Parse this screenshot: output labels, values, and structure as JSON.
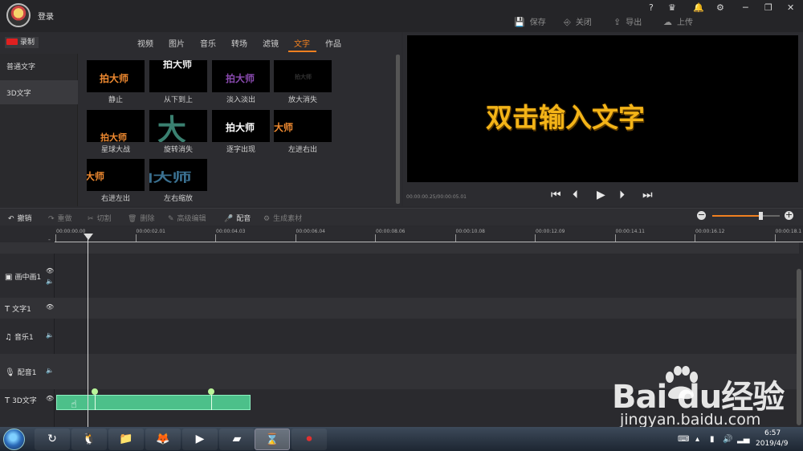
{
  "header": {
    "login": "登录",
    "icons": [
      "help-icon",
      "vip-icon",
      "notification-icon",
      "settings-icon",
      "minimize-icon",
      "restore-icon",
      "close-icon"
    ],
    "help": "?",
    "actions": [
      {
        "label": "保存",
        "icon": "💾"
      },
      {
        "label": "关闭",
        "icon": "⎆"
      },
      {
        "label": "导出",
        "icon": "⇪"
      },
      {
        "label": "上传",
        "icon": "☁"
      }
    ]
  },
  "library": {
    "record_label": "录制",
    "tabs": [
      "视频",
      "图片",
      "音乐",
      "转场",
      "滤镜",
      "文字",
      "作品"
    ],
    "active_tab": "文字",
    "categories": [
      "普通文字",
      "3D文字"
    ],
    "effects": [
      {
        "label": "静止",
        "sample": "拍大师",
        "color": "#f08a30"
      },
      {
        "label": "从下到上",
        "sample": "拍大师",
        "color": "#f0f0f0"
      },
      {
        "label": "淡入淡出",
        "sample": "拍大师",
        "color": "#8a4ab0"
      },
      {
        "label": "放大消失",
        "sample": "拍大师",
        "color": "#333333"
      },
      {
        "label": "星球大战",
        "sample": "拍大师",
        "color": "#f08a30"
      },
      {
        "label": "旋转消失",
        "sample": "大",
        "color": "#3a8070"
      },
      {
        "label": "逐字出现",
        "sample": "拍大师",
        "color": "#ffffff"
      },
      {
        "label": "左进右出",
        "sample": "大师",
        "color": "#f08a30"
      },
      {
        "label": "右进左出",
        "sample": "大师",
        "color": "#f08a30"
      },
      {
        "label": "左右缩放",
        "sample": "拍大师",
        "color": "#3a7090"
      }
    ]
  },
  "preview": {
    "text": "双击输入文字",
    "time": "00:00:00.25/00:00:05.01",
    "controls": [
      "⏮",
      "⏴",
      "▶",
      "⏵",
      "⏭"
    ]
  },
  "toolbar": {
    "items": [
      {
        "label": "撤销",
        "icon": "↶",
        "enabled": true
      },
      {
        "label": "重做",
        "icon": "↷",
        "enabled": false
      },
      {
        "label": "切割",
        "icon": "✂",
        "enabled": false
      },
      {
        "label": "删除",
        "icon": "🗑",
        "enabled": false
      },
      {
        "label": "高级编辑",
        "icon": "✎",
        "enabled": false
      },
      {
        "label": "配音",
        "icon": "🎤",
        "enabled": true
      },
      {
        "label": "生成素材",
        "icon": "⚙",
        "enabled": false
      }
    ],
    "zoom_level": 0.72,
    "zoom_minus": "−",
    "zoom_plus": "+"
  },
  "timeline": {
    "ruler_labels": [
      "00:00:00.00",
      "00:00:02.01",
      "00:00:04.03",
      "00:00:06.04",
      "00:00:08.06",
      "00:00:10.08",
      "00:00:12.09",
      "00:00:14.11",
      "00:00:16.12",
      "00:00:18.1"
    ],
    "dash": "-",
    "tracks": [
      {
        "name": "画中画1",
        "icon": "▣",
        "vis": "👁",
        "audio": "🔈"
      },
      {
        "name": "文字1",
        "icon": "T",
        "vis": "👁",
        "audio": ""
      },
      {
        "name": "音乐1",
        "icon": "♫",
        "vis": "",
        "audio": "🔈"
      },
      {
        "name": "配音1",
        "icon": "🎙",
        "vis": "",
        "audio": "🔈"
      },
      {
        "name": "3D文字",
        "icon": "T",
        "vis": "👁",
        "audio": ""
      }
    ]
  },
  "taskbar": {
    "apps": [
      "↻",
      "🐧",
      "📁",
      "🦊",
      "▶",
      "▰",
      "⌛",
      "⏺"
    ],
    "time": "6:57",
    "date": "2019/4/9"
  },
  "watermark": {
    "logo": "Bai   du经验",
    "url": "jingyan.baidu.com"
  }
}
